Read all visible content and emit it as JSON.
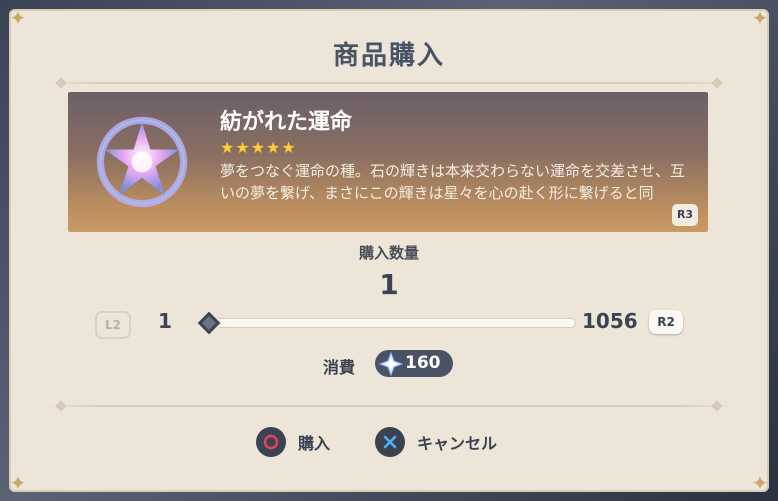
{
  "dialog": {
    "title": "商品購入"
  },
  "item": {
    "name": "紡がれた運命",
    "rarity_stars": "★★★★★",
    "rarity": 5,
    "description": "夢をつなぐ運命の種。石の輝きは本来交わらない運命を交差させ、互いの夢を繋げ、まさにこの輝きは星々を心の赴く形に繋げると同",
    "scroll_button": "R3"
  },
  "quantity": {
    "label": "購入数量",
    "value": "1",
    "min": "1",
    "max": "1056",
    "decrease_button": "L2",
    "increase_button": "R2",
    "slider_fraction": 0
  },
  "cost": {
    "label": "消費",
    "amount": "160",
    "currency_icon": "starglitter-icon"
  },
  "actions": {
    "buy_label": "購入",
    "cancel_label": "キャンセル",
    "buy_icon": "circle-button-icon",
    "cancel_icon": "cross-button-icon"
  },
  "colors": {
    "panel": "#ece5d8",
    "text_dark": "#3b4252",
    "accent_star": "#ffcc33",
    "circle_red": "#e0455a",
    "cross_blue": "#4fb3f0"
  }
}
